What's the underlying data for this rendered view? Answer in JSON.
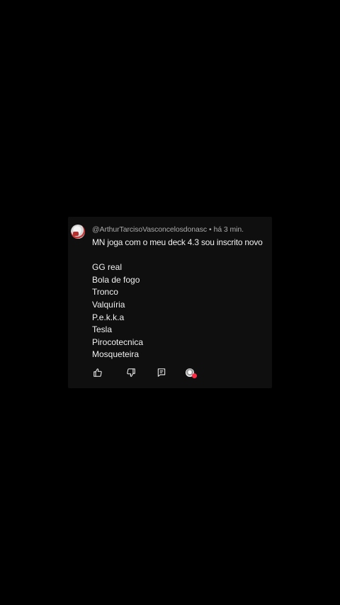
{
  "comment": {
    "author": "@ArthurTarcisoVasconcelosdonasc",
    "separator": "•",
    "time": "há 3 min.",
    "text_first": "MN joga com o meu deck 4.3 sou inscrito novo",
    "deck": [
      "GG real",
      "Bola de fogo",
      "Tronco",
      "Valquíria",
      "P.e.k.k.a",
      "Tesla",
      "Pirocotecnica",
      "Mosqueteira"
    ]
  },
  "actions": {
    "like_icon": "thumbs-up-icon",
    "dislike_icon": "thumbs-down-icon",
    "reply_icon": "reply-comment-icon",
    "creator_heart_icon": "creator-heart-icon"
  },
  "colors": {
    "background": "#000000",
    "card": "#0f0f0f",
    "text": "#f1f1f1",
    "meta": "#aaaaaa",
    "heart": "#ff2a44"
  }
}
